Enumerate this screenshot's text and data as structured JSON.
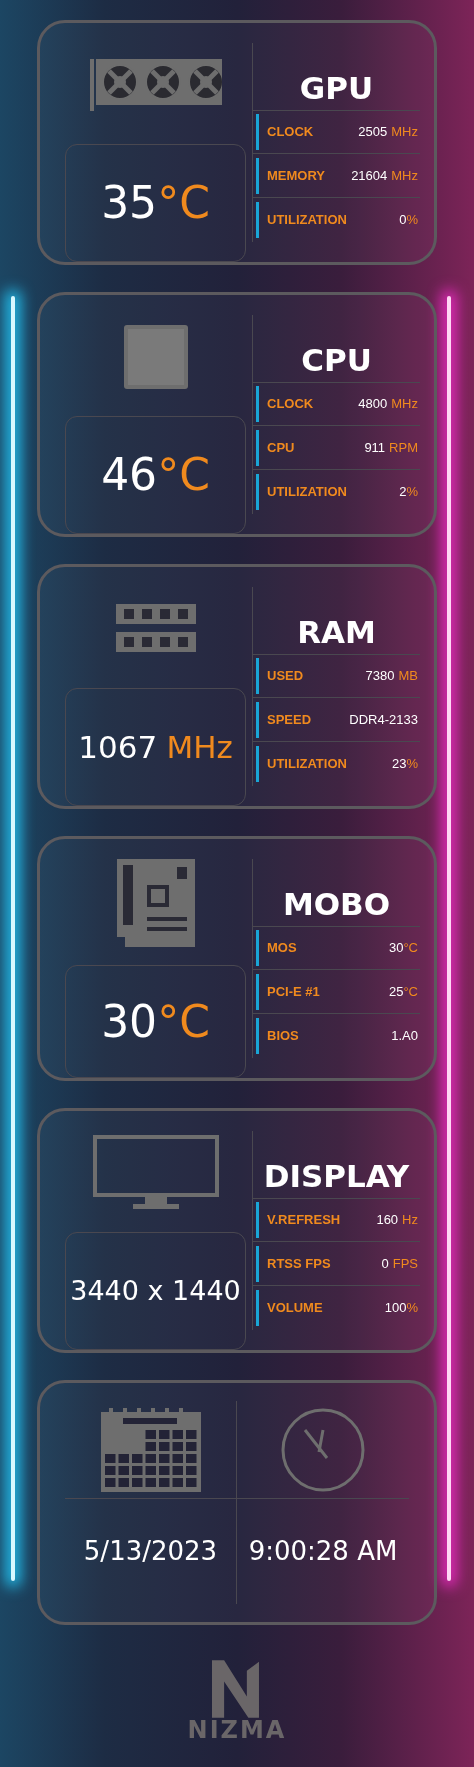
{
  "panels": [
    {
      "kind": "gpu",
      "title": "GPU",
      "reading": {
        "value": "35",
        "unit": "°C"
      },
      "stats": [
        {
          "label": "CLOCK",
          "value": "2505",
          "unit": "MHz"
        },
        {
          "label": "MEMORY",
          "value": "21604",
          "unit": "MHz"
        },
        {
          "label": "UTILIZATION",
          "value": "0",
          "unit": "%"
        }
      ]
    },
    {
      "kind": "cpu",
      "title": "CPU",
      "reading": {
        "value": "46",
        "unit": "°C"
      },
      "stats": [
        {
          "label": "CLOCK",
          "value": "4800",
          "unit": "MHz"
        },
        {
          "label": "CPU",
          "value": "911",
          "unit": "RPM"
        },
        {
          "label": "UTILIZATION",
          "value": "2",
          "unit": "%"
        }
      ]
    },
    {
      "kind": "ram",
      "title": "RAM",
      "reading": {
        "value": "1067",
        "unit": "MHz"
      },
      "stats": [
        {
          "label": "USED",
          "value": "7380",
          "unit": "MB"
        },
        {
          "label": "SPEED",
          "value": "DDR4-2133"
        },
        {
          "label": "UTILIZATION",
          "value": "23",
          "unit": "%"
        }
      ]
    },
    {
      "kind": "mobo",
      "title": "MOBO",
      "reading": {
        "value": "30",
        "unit": "°C"
      },
      "stats": [
        {
          "label": "MOS",
          "value": "30",
          "unit": "°C"
        },
        {
          "label": "PCI-E #1",
          "value": "25",
          "unit": "°C"
        },
        {
          "label": "BIOS",
          "value": "1.A0"
        }
      ]
    },
    {
      "kind": "display",
      "title": "DISPLAY",
      "reading": {
        "value": "3440 x 1440"
      },
      "stats": [
        {
          "label": "V.REFRESH",
          "value": "160",
          "unit": "Hz"
        },
        {
          "label": "RTSS FPS",
          "value": "0",
          "unit": "FPS"
        },
        {
          "label": "VOLUME",
          "value": "100",
          "unit": "%"
        }
      ]
    }
  ],
  "datetime": {
    "date": "5/13/2023",
    "time": "9:00:28 AM"
  },
  "logo": "NIZMA"
}
